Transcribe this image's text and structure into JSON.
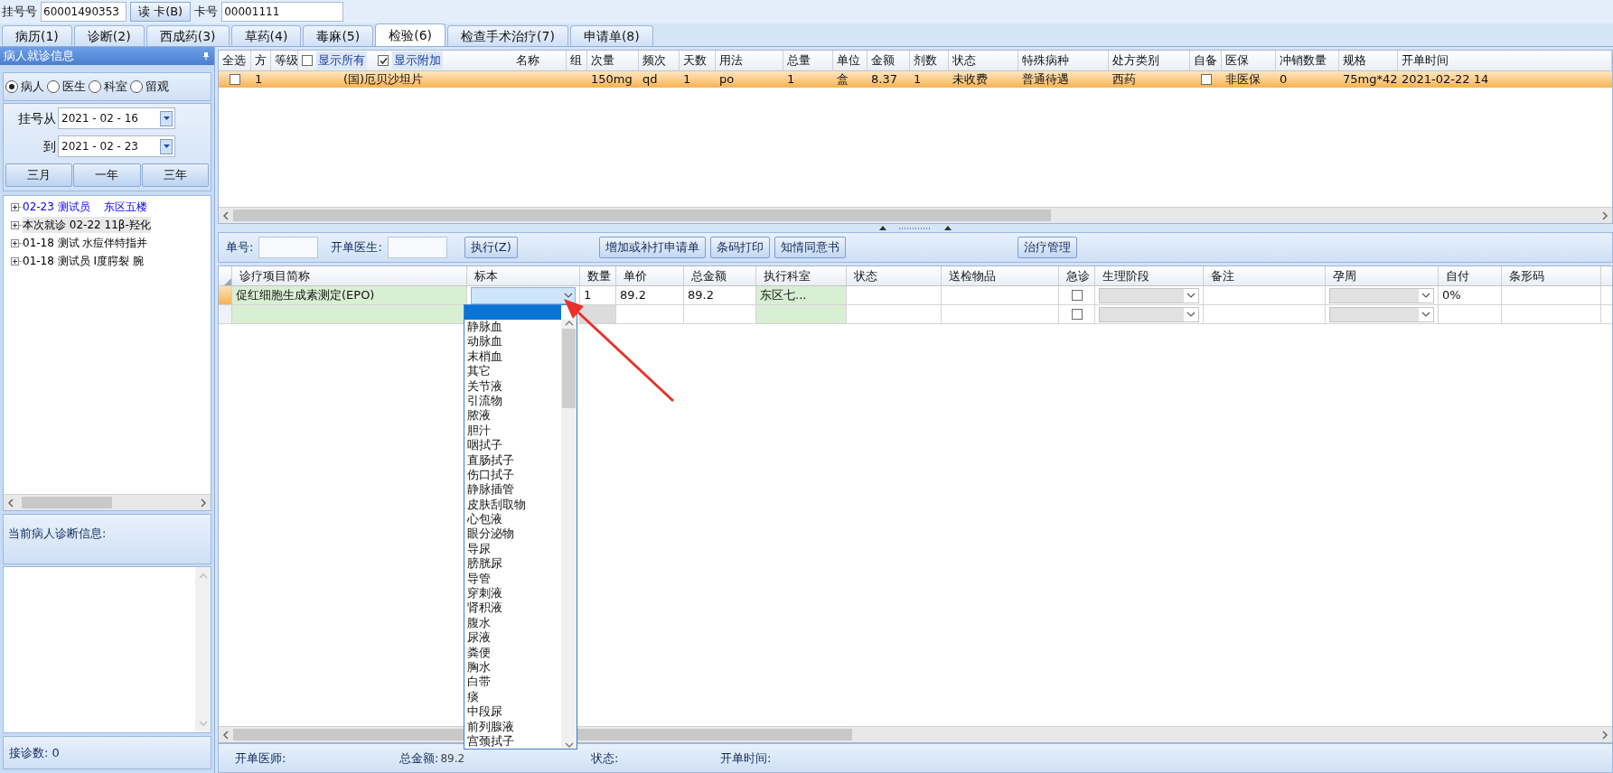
{
  "top_bar": {
    "reg_label": "挂号号",
    "reg_value": "60001490353",
    "read_button": "读 卡(B)",
    "card_label": "卡号",
    "card_value": "00001111"
  },
  "tabs": [
    {
      "label": "病历(1)",
      "selected": false
    },
    {
      "label": "诊断(2)",
      "selected": false
    },
    {
      "label": "西成药(3)",
      "selected": false
    },
    {
      "label": "草药(4)",
      "selected": false
    },
    {
      "label": "毒麻(5)",
      "selected": false
    },
    {
      "label": "检验(6)",
      "selected": true
    },
    {
      "label": "检查手术治疗(7)",
      "selected": false
    },
    {
      "label": "申请单(8)",
      "selected": false
    }
  ],
  "left_panel": {
    "title": "病人就诊信息",
    "radios": [
      {
        "label": "病人",
        "selected": true
      },
      {
        "label": "医生",
        "selected": false
      },
      {
        "label": "科室",
        "selected": false
      },
      {
        "label": "留观",
        "selected": false
      }
    ],
    "date_from_label": "挂号从",
    "date_from": "2021 - 02 - 16",
    "date_to_label": "到",
    "date_to": "2021 - 02 - 23",
    "range_buttons": [
      "三月",
      "一年",
      "三年"
    ],
    "visits": [
      {
        "text": "02-23 测试员    东区五楼",
        "selected": false,
        "color": "#0000ff"
      },
      {
        "text": "本次就诊 02-22 11β-羟化",
        "selected": true,
        "color": "#000000"
      },
      {
        "text": "01-18 测试 水痘伴特指并",
        "selected": false,
        "color": "#000000"
      },
      {
        "text": "01-18 测试员 I度腭裂 腕",
        "selected": false,
        "color": "#000000"
      }
    ],
    "diagnosis_title": "当前病人诊断信息:",
    "visit_count": "接诊数: 0"
  },
  "prescription_grid": {
    "header_options": [
      {
        "label": "显示所有",
        "checked": false
      },
      {
        "label": "显示附加",
        "checked": true
      }
    ],
    "columns": [
      {
        "label": "全选"
      },
      {
        "label": "方"
      },
      {
        "label": "等级"
      },
      {
        "label": "名称",
        "kind": "options"
      },
      {
        "label": "组"
      },
      {
        "label": "次量"
      },
      {
        "label": "频次"
      },
      {
        "label": "天数"
      },
      {
        "label": "用法"
      },
      {
        "label": "总量"
      },
      {
        "label": "单位"
      },
      {
        "label": "金额"
      },
      {
        "label": "剂数"
      },
      {
        "label": "状态"
      },
      {
        "label": "特殊病种"
      },
      {
        "label": "处方类别"
      },
      {
        "label": "自备"
      },
      {
        "label": "医保"
      },
      {
        "label": "冲销数量"
      },
      {
        "label": "规格"
      },
      {
        "label": "开单时间"
      }
    ],
    "rows": [
      {
        "selected": true,
        "cells": [
          {
            "kind": "check",
            "checked": false
          },
          {
            "kind": "text",
            "text": "1"
          },
          {
            "kind": "empty"
          },
          {
            "kind": "text",
            "text": "(国)厄贝沙坦片"
          },
          {
            "kind": "empty"
          },
          {
            "kind": "text",
            "text": "150mg"
          },
          {
            "kind": "text",
            "text": "qd"
          },
          {
            "kind": "text",
            "text": "1"
          },
          {
            "kind": "text",
            "text": "po"
          },
          {
            "kind": "text",
            "text": "1"
          },
          {
            "kind": "text",
            "text": "盒"
          },
          {
            "kind": "text",
            "text": "8.37"
          },
          {
            "kind": "text",
            "text": "1"
          },
          {
            "kind": "text",
            "text": "未收费"
          },
          {
            "kind": "text",
            "text": "普通待遇"
          },
          {
            "kind": "text",
            "text": "西药"
          },
          {
            "kind": "check",
            "checked": false
          },
          {
            "kind": "text",
            "text": "非医保"
          },
          {
            "kind": "text",
            "text": "0"
          },
          {
            "kind": "text",
            "text": "75mg*42"
          },
          {
            "kind": "text",
            "text": "2021-02-22 14"
          }
        ]
      }
    ]
  },
  "request_toolbar": {
    "fields": [
      {
        "label": "单号:"
      },
      {
        "label": "开单医生:"
      }
    ],
    "buttons": [
      "执行(Z)",
      "增加或补打申请单",
      "条码打印",
      "知情同意书",
      "治疗管理"
    ]
  },
  "request_grid": {
    "columns": [
      {
        "label": "诊疗项目简称"
      },
      {
        "label": "标本"
      },
      {
        "label": "数量"
      },
      {
        "label": "单价"
      },
      {
        "label": "总金额"
      },
      {
        "label": "执行科室"
      },
      {
        "label": "状态"
      },
      {
        "label": "送检物品"
      },
      {
        "label": "急诊"
      },
      {
        "label": "生理阶段"
      },
      {
        "label": "备注"
      },
      {
        "label": "孕周"
      },
      {
        "label": "自付"
      },
      {
        "label": "条形码"
      }
    ],
    "rows": [
      {
        "current": true,
        "cells": [
          {
            "kind": "text",
            "text": "促红细胞生成素测定(EPO)",
            "color": "#d9efd3"
          },
          {
            "kind": "dropdown",
            "open": true
          },
          {
            "kind": "text",
            "text": "1"
          },
          {
            "kind": "text",
            "text": "89.2"
          },
          {
            "kind": "text",
            "text": "89.2"
          },
          {
            "kind": "text",
            "text": "东区七...",
            "color": "#d9efd3"
          },
          {
            "kind": "empty"
          },
          {
            "kind": "empty"
          },
          {
            "kind": "check",
            "checked": false
          },
          {
            "kind": "select"
          },
          {
            "kind": "empty"
          },
          {
            "kind": "select"
          },
          {
            "kind": "text",
            "text": "0%"
          },
          {
            "kind": "empty"
          }
        ]
      },
      {
        "current": false,
        "cells": [
          {
            "kind": "empty",
            "color": "#d9efd3"
          },
          {
            "kind": "empty"
          },
          {
            "kind": "empty",
            "color": "#dcdcdc"
          },
          {
            "kind": "empty"
          },
          {
            "kind": "empty"
          },
          {
            "kind": "empty",
            "color": "#d9efd3"
          },
          {
            "kind": "empty"
          },
          {
            "kind": "empty"
          },
          {
            "kind": "check",
            "checked": false
          },
          {
            "kind": "select"
          },
          {
            "kind": "empty"
          },
          {
            "kind": "select"
          },
          {
            "kind": "empty"
          },
          {
            "kind": "empty"
          }
        ]
      }
    ],
    "specimen_dropdown": {
      "blank_highlighted": true,
      "options": [
        "静脉血",
        "动脉血",
        "末梢血",
        "其它",
        "关节液",
        "引流物",
        "脓液",
        "胆汁",
        "咽拭子",
        "直肠拭子",
        "伤口拭子",
        "静脉插管",
        "皮肤刮取物",
        "心包液",
        "眼分泌物",
        "导尿",
        "膀胱尿",
        "导管",
        "穿刺液",
        "肾积液",
        "腹水",
        "尿液",
        "粪便",
        "胸水",
        "白带",
        "痰",
        "中段尿",
        "前列腺液",
        "宫颈拭子"
      ]
    }
  },
  "status_bar": [
    {
      "label": "开单医师:"
    },
    {
      "label": "总金额:",
      "value": "89.2"
    },
    {
      "label": "状态:"
    },
    {
      "label": "开单时间:"
    }
  ]
}
